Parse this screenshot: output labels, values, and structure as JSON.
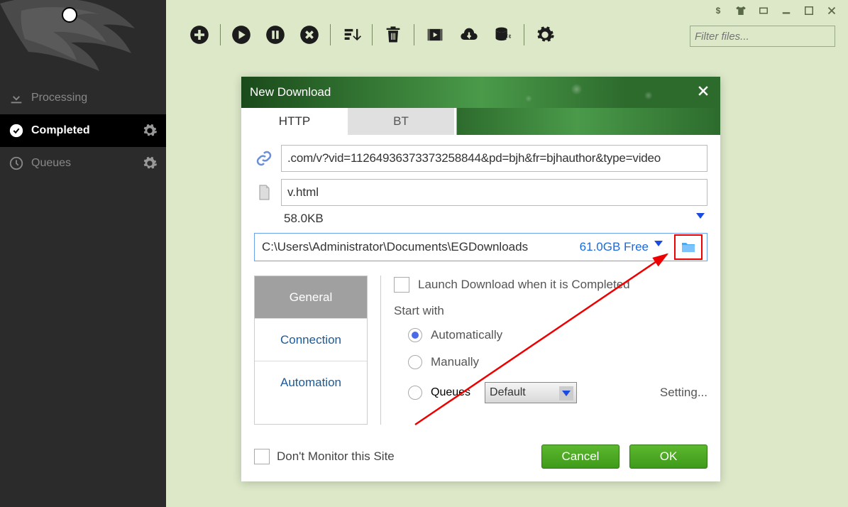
{
  "sidebar": {
    "items": [
      {
        "label": "Processing"
      },
      {
        "label": "Completed"
      },
      {
        "label": "Queues"
      }
    ]
  },
  "toolbar": {
    "filter_placeholder": "Filter files..."
  },
  "dialog": {
    "title": "New Download",
    "tabs": {
      "http": "HTTP",
      "bt": "BT"
    },
    "url": ".com/v?vid=11264936373373258844&pd=bjh&fr=bjhauthor&type=video",
    "filename": "v.html",
    "filesize": "58.0KB",
    "location": "C:\\Users\\Administrator\\Documents\\EGDownloads",
    "free": "61.0GB Free",
    "side_tabs": {
      "general": "General",
      "connection": "Connection",
      "automation": "Automation"
    },
    "launch_label": "Launch Download when it is Completed",
    "start_label": "Start with",
    "radio_auto": "Automatically",
    "radio_manual": "Manually",
    "radio_queues": "Queues",
    "queue_default": "Default",
    "setting": "Setting...",
    "dont_monitor": "Don't Monitor this Site",
    "cancel": "Cancel",
    "ok": "OK"
  }
}
